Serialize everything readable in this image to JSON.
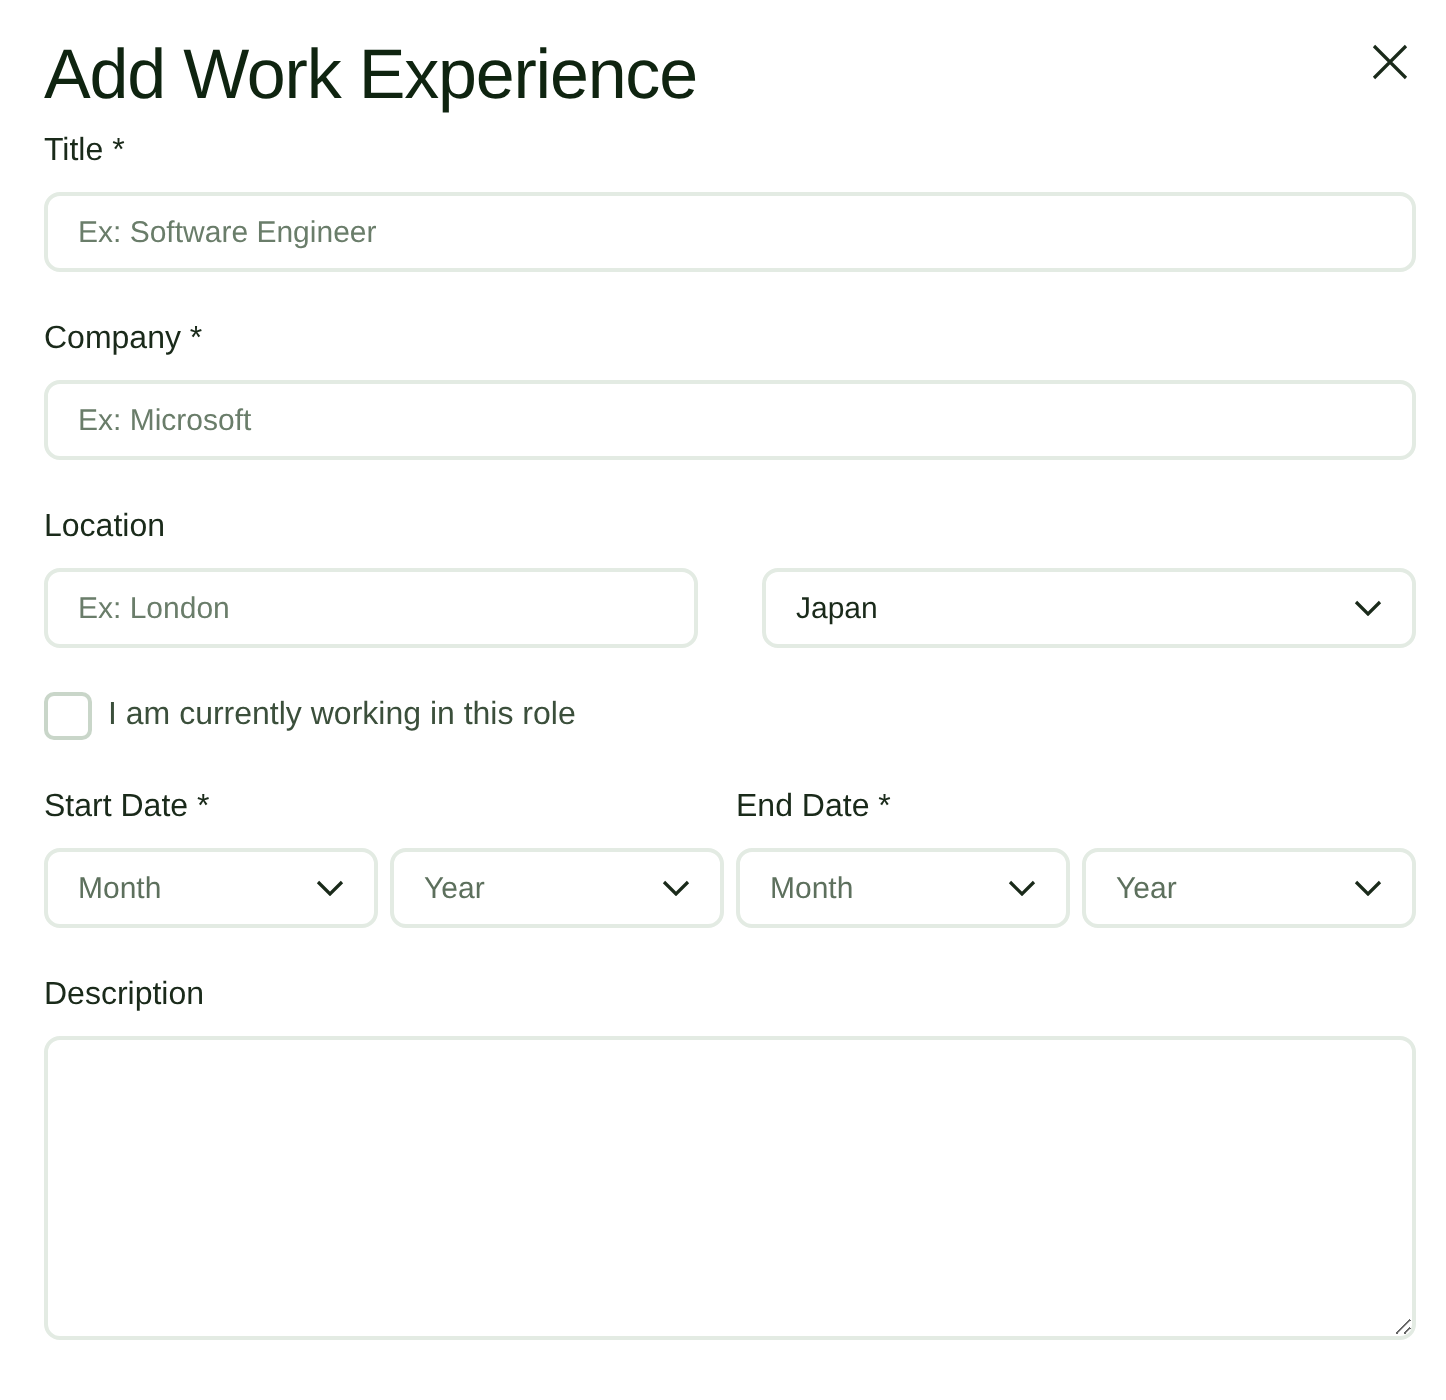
{
  "title": "Add Work Experience",
  "fields": [
    {
      "label": "Title *",
      "placeholder": "Ex: Software Engineer"
    },
    {
      "label": "Company *",
      "placeholder": "Ex: Microsoft"
    }
  ],
  "location": {
    "label": "Location",
    "city": {
      "placeholder": "Ex: London"
    },
    "country": {
      "value": "Japan"
    }
  },
  "current_role": {
    "label": "I am currently working in this role",
    "checked": false
  },
  "dates": [
    {
      "label": "Start Date *",
      "month": {
        "placeholder": "Month"
      },
      "year": {
        "placeholder": "Year"
      }
    },
    {
      "label": "End Date *",
      "month": {
        "placeholder": "Month"
      },
      "year": {
        "placeholder": "Year"
      }
    }
  ],
  "description": {
    "label": "Description"
  }
}
